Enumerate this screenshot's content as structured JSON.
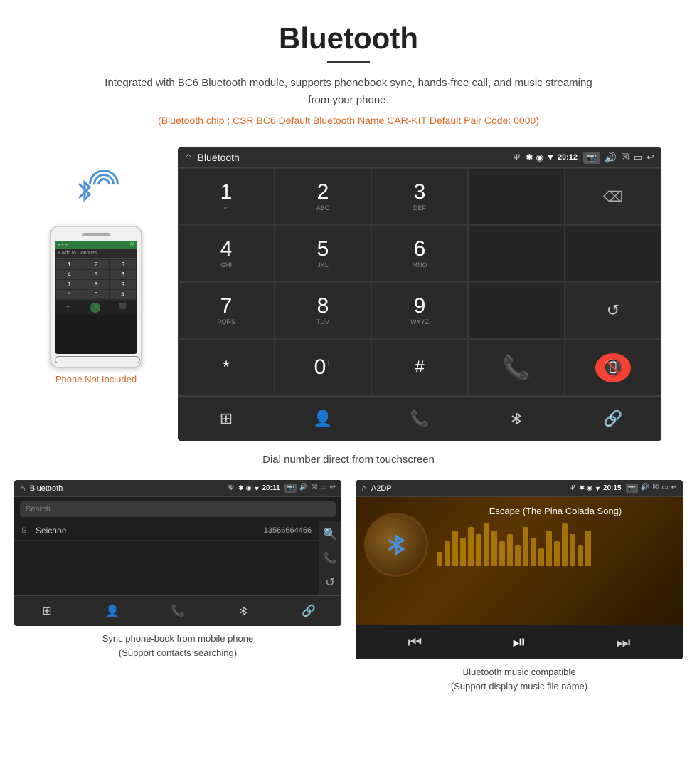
{
  "header": {
    "title": "Bluetooth",
    "description": "Integrated with BC6 Bluetooth module, supports phonebook sync, hands-free call, and music streaming from your phone.",
    "specs": "(Bluetooth chip : CSR BC6    Default Bluetooth Name CAR-KIT    Default Pair Code: 0000)"
  },
  "dial_screen": {
    "topbar": {
      "title": "Bluetooth",
      "usb_symbol": "Ψ",
      "time": "20:12",
      "home_symbol": "⌂",
      "back_symbol": "↩"
    },
    "keypad": [
      {
        "number": "1",
        "letters": "∞",
        "type": "digit"
      },
      {
        "number": "2",
        "letters": "ABC",
        "type": "digit"
      },
      {
        "number": "3",
        "letters": "DEF",
        "type": "digit"
      },
      {
        "number": "",
        "letters": "",
        "type": "empty"
      },
      {
        "number": "⌫",
        "letters": "",
        "type": "special"
      },
      {
        "number": "4",
        "letters": "GHI",
        "type": "digit"
      },
      {
        "number": "5",
        "letters": "JKL",
        "type": "digit"
      },
      {
        "number": "6",
        "letters": "MNO",
        "type": "digit"
      },
      {
        "number": "",
        "letters": "",
        "type": "empty"
      },
      {
        "number": "",
        "letters": "",
        "type": "empty"
      },
      {
        "number": "7",
        "letters": "PQRS",
        "type": "digit"
      },
      {
        "number": "8",
        "letters": "TUV",
        "type": "digit"
      },
      {
        "number": "9",
        "letters": "WXYZ",
        "type": "digit"
      },
      {
        "number": "",
        "letters": "",
        "type": "empty"
      },
      {
        "number": "↺",
        "letters": "",
        "type": "special"
      },
      {
        "number": "*",
        "letters": "",
        "type": "special"
      },
      {
        "number": "0",
        "letters": "+",
        "type": "zero"
      },
      {
        "number": "#",
        "letters": "",
        "type": "special"
      },
      {
        "number": "call_green",
        "letters": "",
        "type": "call_green"
      },
      {
        "number": "call_red",
        "letters": "",
        "type": "call_red"
      }
    ],
    "bottom_nav": [
      "⊞",
      "👤",
      "📞",
      "✱",
      "🔗"
    ],
    "caption": "Dial number direct from touchscreen"
  },
  "phone_illustration": {
    "not_included": "Phone Not Included",
    "add_to_contacts": "+ Add to Contacts",
    "keypad_keys": [
      "1",
      "2",
      "3",
      "4",
      "5",
      "6",
      "7",
      "8",
      "9",
      "*",
      "0",
      "#"
    ]
  },
  "phonebook_screen": {
    "topbar_title": "Bluetooth",
    "topbar_time": "20:11",
    "search_placeholder": "Search",
    "contacts": [
      {
        "letter": "S",
        "name": "Seicane",
        "number": "13566664466"
      }
    ],
    "right_icons": [
      "🔍",
      "📞",
      "↺"
    ],
    "bottom_nav": [
      "⊞",
      "👤",
      "📞",
      "✱",
      "🔗"
    ],
    "caption_line1": "Sync phone-book from mobile phone",
    "caption_line2": "(Support contacts searching)"
  },
  "music_screen": {
    "topbar_title": "A2DP",
    "topbar_time": "20:15",
    "song_title": "Escape (The Pina Colada Song)",
    "eq_bars": [
      20,
      35,
      50,
      40,
      55,
      45,
      60,
      50,
      35,
      45,
      30,
      55,
      40,
      25,
      50,
      35,
      60,
      45,
      30,
      50
    ],
    "controls": [
      "prev",
      "playpause",
      "next"
    ],
    "caption_line1": "Bluetooth music compatible",
    "caption_line2": "(Support display music file name)"
  }
}
